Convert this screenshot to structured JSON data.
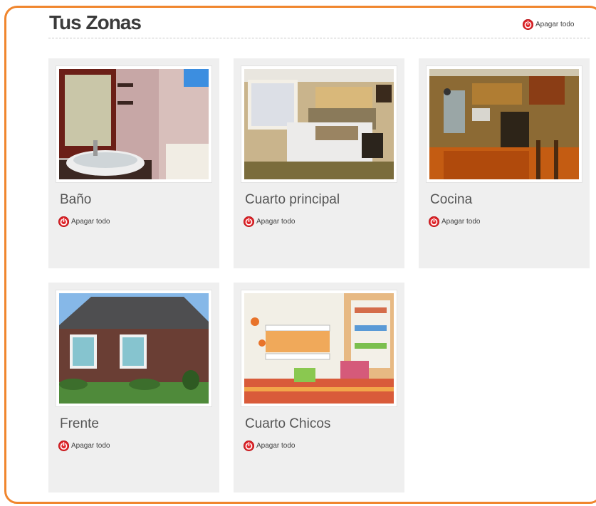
{
  "header": {
    "title": "Tus Zonas",
    "all_off_label": "Apagar todo"
  },
  "zones": [
    {
      "name": "Baño",
      "off_label": "Apagar todo",
      "image": "bathroom-photo"
    },
    {
      "name": "Cuarto principal",
      "off_label": "Apagar todo",
      "image": "bedroom-photo"
    },
    {
      "name": "Cocina",
      "off_label": "Apagar todo",
      "image": "kitchen-photo"
    },
    {
      "name": "Frente",
      "off_label": "Apagar todo",
      "image": "house-front-photo"
    },
    {
      "name": "Cuarto Chicos",
      "off_label": "Apagar todo",
      "image": "kids-room-photo"
    }
  ],
  "colors": {
    "frame": "#f0862e",
    "card_bg": "#efefef",
    "power_icon": "#e0252a"
  },
  "icons": {
    "power": "power-icon"
  }
}
